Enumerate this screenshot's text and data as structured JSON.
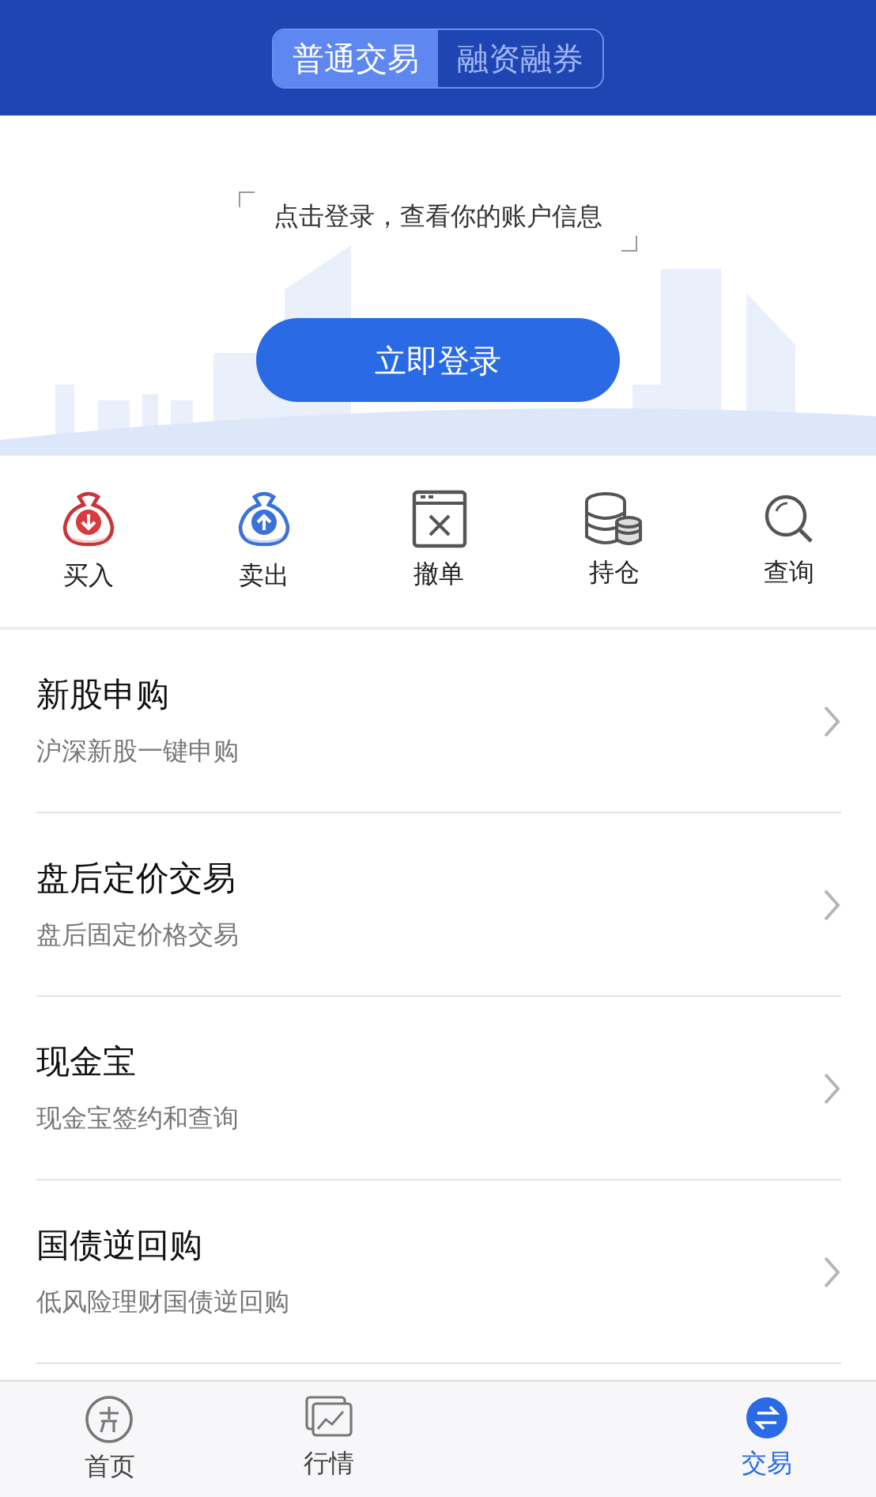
{
  "header": {
    "segments": [
      {
        "label": "普通交易",
        "selected": true
      },
      {
        "label": "融资融券",
        "selected": false
      }
    ]
  },
  "login": {
    "prompt": "点击登录，查看你的账户信息",
    "button": "立即登录"
  },
  "quick_actions": [
    {
      "label": "买入",
      "kind": "buy"
    },
    {
      "label": "卖出",
      "kind": "sell"
    },
    {
      "label": "撤单",
      "kind": "cancel"
    },
    {
      "label": "持仓",
      "kind": "holdings"
    },
    {
      "label": "查询",
      "kind": "query"
    }
  ],
  "menu": [
    {
      "title": "新股申购",
      "subtitle": "沪深新股一键申购"
    },
    {
      "title": "盘后定价交易",
      "subtitle": "盘后固定价格交易"
    },
    {
      "title": "现金宝",
      "subtitle": "现金宝签约和查询"
    },
    {
      "title": "国债逆回购",
      "subtitle": "低风险理财国债逆回购"
    }
  ],
  "tab_bar": [
    {
      "label": "首页",
      "kind": "home",
      "selected": false
    },
    {
      "label": "行情",
      "kind": "market",
      "selected": false
    },
    {
      "label": "交易",
      "kind": "trade",
      "selected": true
    }
  ]
}
